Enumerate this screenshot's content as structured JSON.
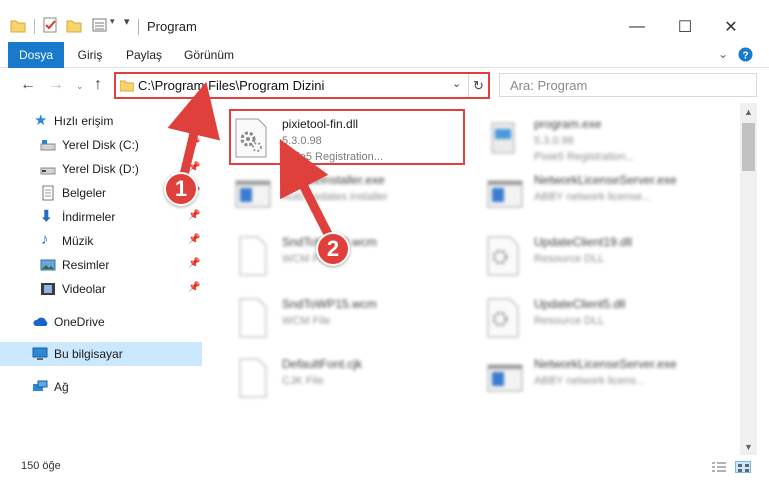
{
  "window": {
    "title": "Program",
    "controls": {
      "minimize": "—",
      "maximize": "☐",
      "close": "✕"
    }
  },
  "ribbon": {
    "tabs": [
      {
        "label": "Dosya",
        "active": true
      },
      {
        "label": "Giriş",
        "active": false
      },
      {
        "label": "Paylaş",
        "active": false
      },
      {
        "label": "Görünüm",
        "active": false
      }
    ],
    "expand_icon": "chevron-down-icon",
    "help_icon": "help-icon"
  },
  "address": {
    "path": "C:\\Program Files\\Program Dizini",
    "search_placeholder": "Ara: Program"
  },
  "sidebar": {
    "items": [
      {
        "label": "Hızlı erişim",
        "icon": "star-icon"
      },
      {
        "label": "Yerel Disk (C:)",
        "icon": "drive-icon"
      },
      {
        "label": "Yerel Disk (D:)",
        "icon": "drive-icon"
      },
      {
        "label": "Belgeler",
        "icon": "documents-icon"
      },
      {
        "label": "İndirmeler",
        "icon": "download-icon"
      },
      {
        "label": "Müzik",
        "icon": "music-icon"
      },
      {
        "label": "Resimler",
        "icon": "pictures-icon"
      },
      {
        "label": "Videolar",
        "icon": "video-icon"
      },
      {
        "label": "OneDrive",
        "icon": "cloud-icon"
      },
      {
        "label": "Bu bilgisayar",
        "icon": "computer-icon"
      },
      {
        "label": "Ağ",
        "icon": "network-icon"
      }
    ]
  },
  "files": [
    {
      "name": "pixietool-fin.dll",
      "line2": "5.3.0.98",
      "line3": "Pixie5 Registration...",
      "icon": "dll-gear-icon"
    },
    {
      "name": "program.exe",
      "line2": "5.3.0.98",
      "line3": "Pixie5 Registration...",
      "icon": "exe-icon"
    },
    {
      "name": "UpdateInstaller.exe",
      "line2": "Auto updates installer",
      "line3": "",
      "icon": "exe-window-icon"
    },
    {
      "name": "NetworkLicenseServer.exe",
      "line2": "ABBY network license...",
      "line3": "",
      "icon": "exe-window-icon"
    },
    {
      "name": "SndToWP19.wcm",
      "line2": "WCM File",
      "line3": "",
      "icon": "blank-file-icon"
    },
    {
      "name": "UpdateClient19.dll",
      "line2": "Resource DLL",
      "line3": "",
      "icon": "dll-gear-icon"
    },
    {
      "name": "SndToWP15.wcm",
      "line2": "WCM File",
      "line3": "",
      "icon": "blank-file-icon"
    },
    {
      "name": "UpdateClient5.dll",
      "line2": "Resource DLL",
      "line3": "",
      "icon": "dll-gear-icon"
    },
    {
      "name": "DefaultFont.cjk",
      "line2": "CJK File",
      "line3": "",
      "icon": "blank-file-icon"
    },
    {
      "name": "NetworkLicenseServer.exe",
      "line2": "ABBY network licens...",
      "line3": "",
      "icon": "exe-window-icon"
    }
  ],
  "status": {
    "item_count": "150 öğe"
  },
  "callouts": {
    "step1": "1",
    "step2": "2"
  },
  "colors": {
    "accent": "#1979ca",
    "highlight": "#e0403b",
    "selected": "#cce8ff"
  }
}
